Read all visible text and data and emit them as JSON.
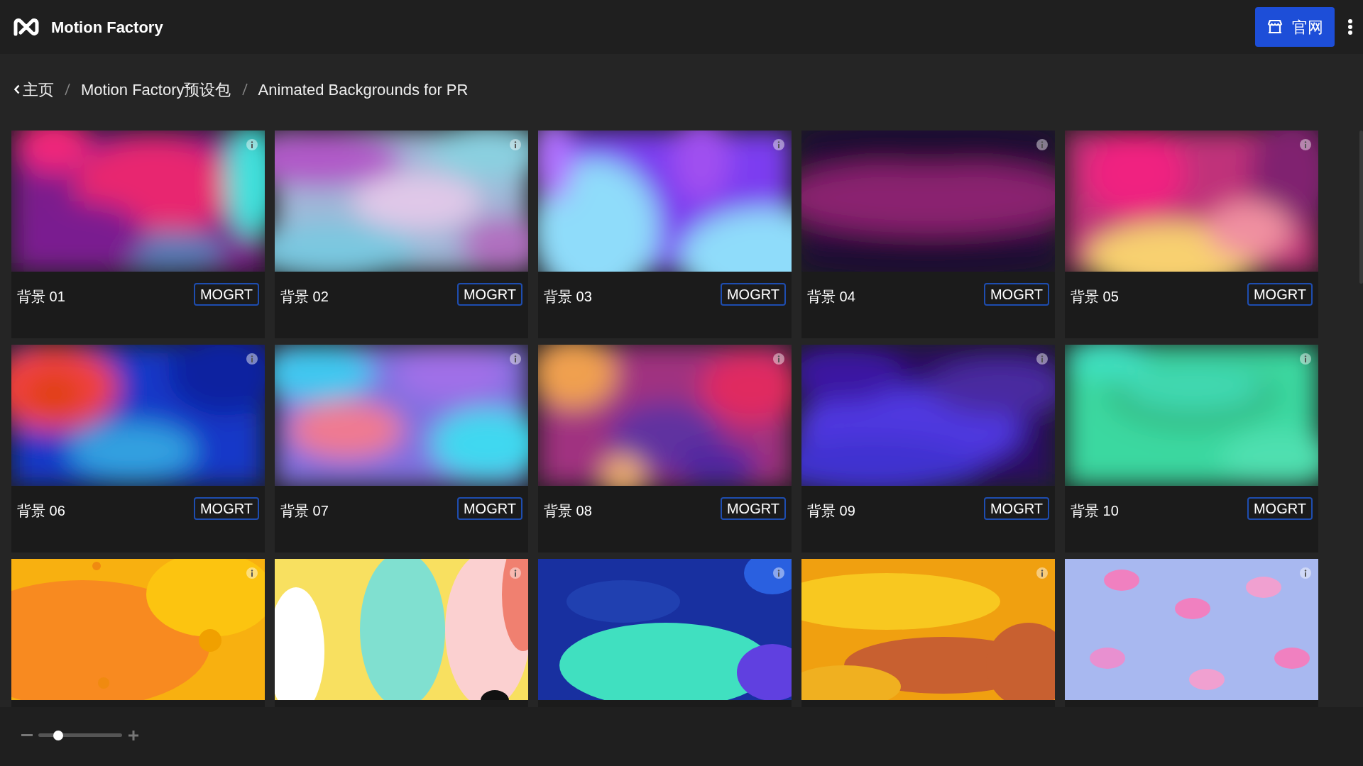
{
  "app": {
    "title": "Motion Factory",
    "official_button": "官网"
  },
  "breadcrumb": [
    {
      "label": "主页",
      "kind": "back"
    },
    {
      "label": "Motion Factory预设包",
      "kind": "link"
    },
    {
      "label": "Animated Backgrounds for PR",
      "kind": "current"
    }
  ],
  "cards": [
    {
      "kind": "template",
      "title": "背景 01",
      "badge": "MOGRT"
    },
    {
      "kind": "template",
      "title": "背景 02",
      "badge": "MOGRT"
    },
    {
      "kind": "template",
      "title": "背景 03",
      "badge": "MOGRT"
    },
    {
      "kind": "template",
      "title": "背景 04",
      "badge": "MOGRT"
    },
    {
      "kind": "template",
      "title": "背景 05",
      "badge": "MOGRT"
    },
    {
      "kind": "template",
      "title": "背景 06",
      "badge": "MOGRT"
    },
    {
      "kind": "template",
      "title": "背景 07",
      "badge": "MOGRT"
    },
    {
      "kind": "template",
      "title": "背景 08",
      "badge": "MOGRT"
    },
    {
      "kind": "template",
      "title": "背景 09",
      "badge": "MOGRT"
    },
    {
      "kind": "template",
      "title": "背景 10",
      "badge": "MOGRT"
    },
    {
      "kind": "picture"
    },
    {
      "kind": "picture"
    },
    {
      "kind": "picture"
    },
    {
      "kind": "picture"
    },
    {
      "kind": "picture"
    }
  ],
  "zoom_slider": {
    "level": 0.2
  }
}
